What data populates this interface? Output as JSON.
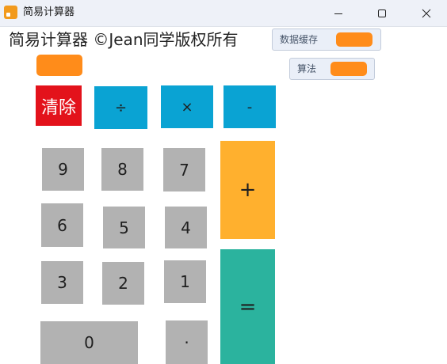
{
  "window": {
    "title": "简易计算器",
    "icon": "app-icon",
    "controls": [
      "minimize-icon",
      "maximize-icon",
      "close-icon"
    ]
  },
  "header": {
    "text": "简易计算器 ©Jean同学版权所有"
  },
  "monitors": {
    "cache": {
      "label": "数据缓存",
      "value": ""
    },
    "algorithm": {
      "label": "算法",
      "value": ""
    }
  },
  "display": {
    "value": ""
  },
  "keys": {
    "clear": "清除",
    "divide": "÷",
    "multiply": "×",
    "minus": "-",
    "plus": "+",
    "equals": "=",
    "n9": "9",
    "n8": "8",
    "n7": "7",
    "n6": "6",
    "n5": "5",
    "n4": "4",
    "n3": "3",
    "n2": "2",
    "n1": "1",
    "n0": "0",
    "dot": "·"
  },
  "colors": {
    "clear": "#e3121b",
    "operator": "#0aa3d3",
    "number": "#b2b2b2",
    "plus": "#ffb02e",
    "equals": "#2bb39e",
    "variable": "#ff8c1a"
  }
}
